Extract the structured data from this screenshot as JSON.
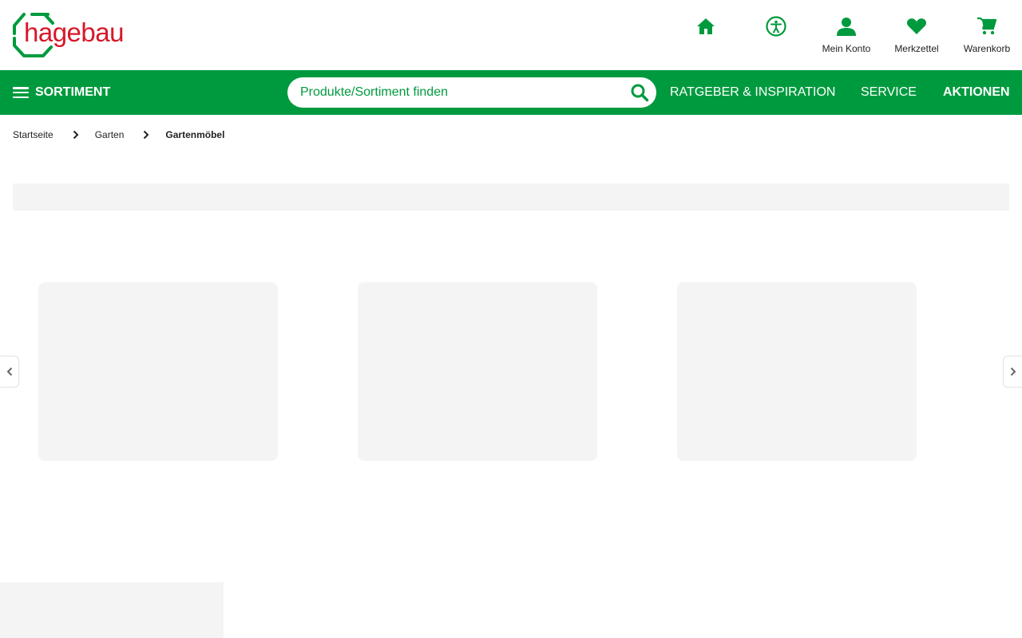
{
  "brand": {
    "logo_text": "hagebau",
    "logo_color": "#d7182a",
    "accent_color": "#009a3e"
  },
  "header": {
    "icons": [
      {
        "name": "home-icon",
        "label": ""
      },
      {
        "name": "accessibility-icon",
        "label": ""
      },
      {
        "name": "user-icon",
        "label": "Mein Konto"
      },
      {
        "name": "heart-icon",
        "label": "Merkzettel"
      },
      {
        "name": "cart-icon",
        "label": "Warenkorb"
      }
    ]
  },
  "navbar": {
    "sortiment_label": "SORTIMENT",
    "search_placeholder": "Produkte/Sortiment finden",
    "links": [
      "RATGEBER & INSPIRATION",
      "SERVICE",
      "AKTIONEN"
    ]
  },
  "breadcrumb": {
    "items": [
      "Startseite",
      "Garten",
      "Gartenmöbel"
    ]
  }
}
